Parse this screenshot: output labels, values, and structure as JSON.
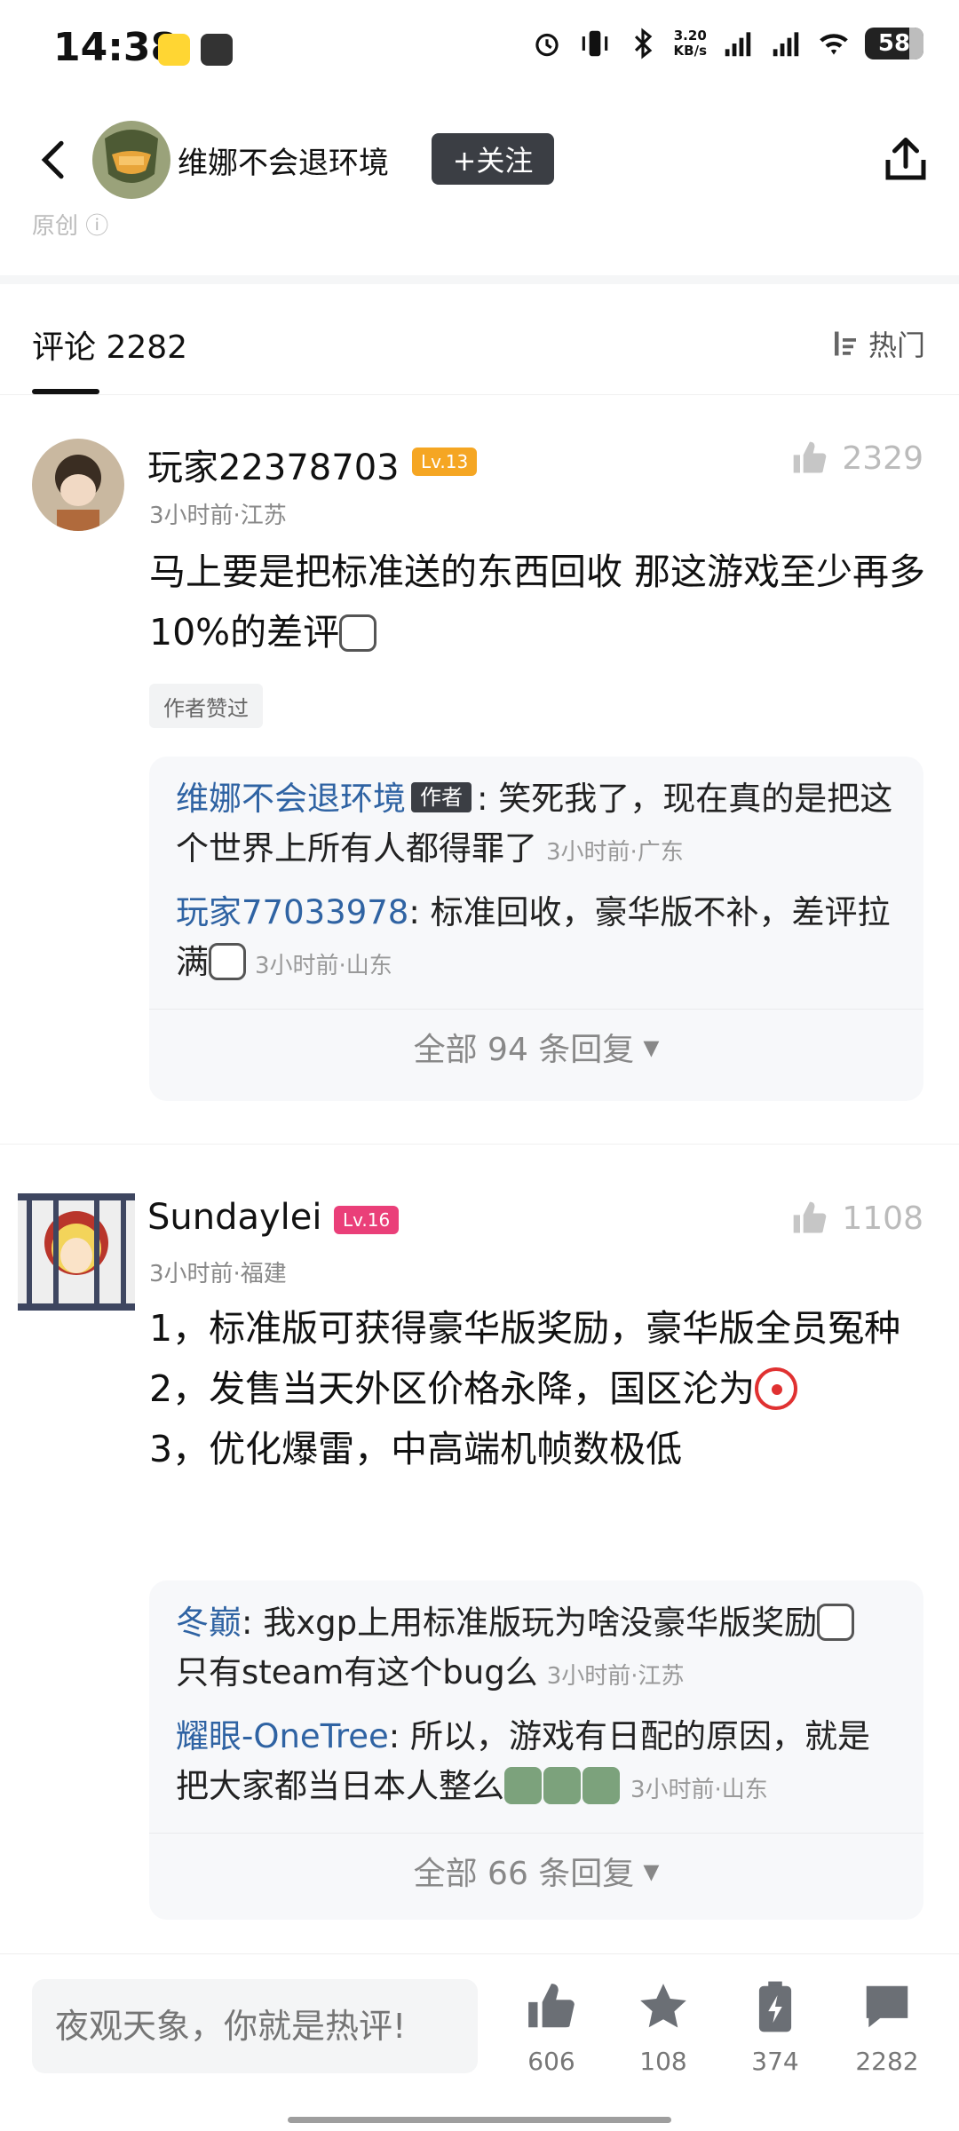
{
  "status": {
    "time": "14:38",
    "net_speed_value": "3.20",
    "net_speed_unit": "KB/s",
    "signal1": "5G",
    "signal2": "5G",
    "battery": "58"
  },
  "header": {
    "author_name": "维娜不会退环境",
    "follow_label": "+关注",
    "original_label": "原创"
  },
  "tabs": {
    "comments_label": "评论 2282",
    "sort_label": "热门"
  },
  "comments": [
    {
      "name": "玩家22378703",
      "level": "Lv.13",
      "level_color": "#f5a623",
      "meta": "3小时前·江苏",
      "likes": "2329",
      "body": "马上要是把标准送的东西回收 那这游戏至少再多10%的差评",
      "tag": "作者赞过",
      "replies": [
        {
          "name": "维娜不会退环境",
          "author_tag": "作者",
          "text": "笑死我了，现在真的是把这个世界上所有人都得罪了",
          "time": "3小时前·广东"
        },
        {
          "name": "玩家77033978",
          "text": "标准回收，豪华版不补，差评拉满",
          "time": "3小时前·山东"
        }
      ],
      "view_all": "全部 94 条回复"
    },
    {
      "name": "Sundaylei",
      "level": "Lv.16",
      "level_color": "#ea3f79",
      "meta": "3小时前·福建",
      "likes": "1108",
      "body_lines": [
        "1，标准版可获得豪华版奖励，豪华版全员冤种",
        "2，发售当天外区价格永降，国区沦为",
        "3，优化爆雷，中高端机帧数极低"
      ],
      "replies": [
        {
          "name": "冬巅",
          "text": "我xgp上用标准版玩为啥没豪华版奖励",
          "text2": "只有steam有这个bug么",
          "time": "3小时前·江苏"
        },
        {
          "name": "耀眼-OneTree",
          "text": "所以，游戏有日配的原因，就是把大家都当日本人整么",
          "time": "3小时前·山东"
        }
      ],
      "view_all": "全部 66 条回复"
    }
  ],
  "bottom_bar": {
    "input_placeholder": "夜观天象，你就是热评!",
    "likes": "606",
    "favorites": "108",
    "charges": "374",
    "comments": "2282"
  },
  "colors": {
    "reply_name": "#2f63a3",
    "follow_bg": "#3b3e44"
  }
}
